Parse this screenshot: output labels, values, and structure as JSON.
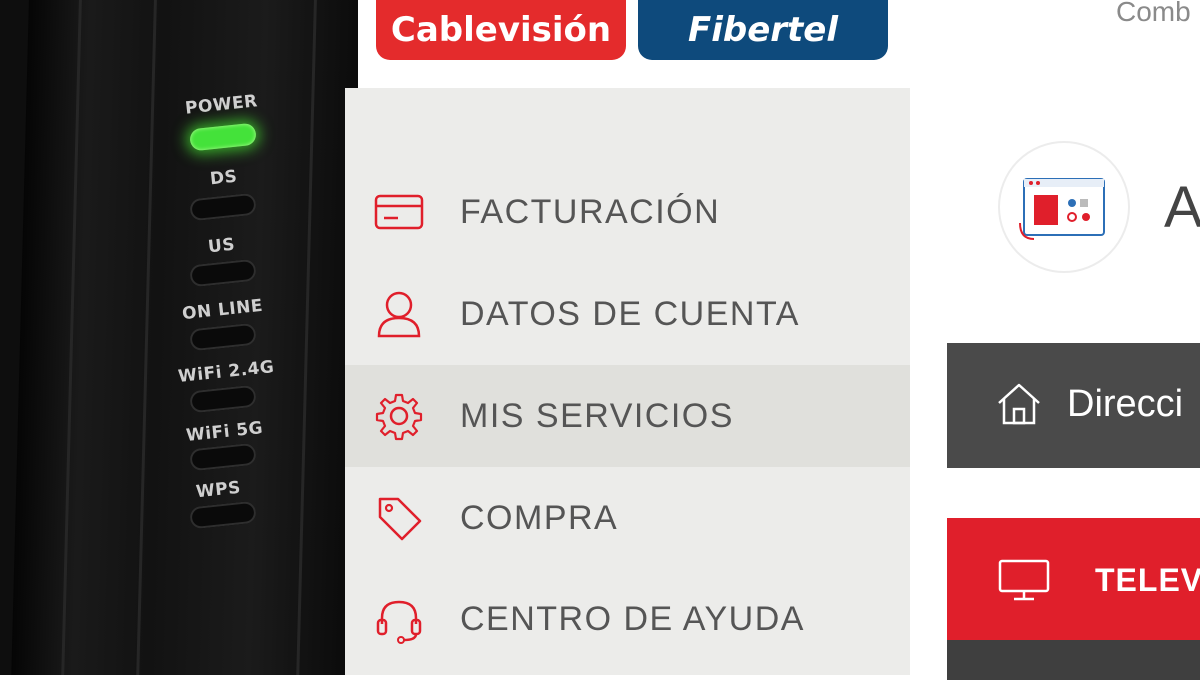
{
  "router": {
    "leds": [
      {
        "label": "POWER",
        "state": "on"
      },
      {
        "label": "DS",
        "state": "off"
      },
      {
        "label": "US",
        "state": "off"
      },
      {
        "label": "ON LINE",
        "state": "off"
      },
      {
        "label": "WiFi 2.4G",
        "state": "off"
      },
      {
        "label": "WiFi 5G",
        "state": "off"
      },
      {
        "label": "WPS",
        "state": "off"
      }
    ],
    "led_on_color": "#44e23a"
  },
  "header": {
    "logo_cablevision": "Cablevisión",
    "logo_fibertel": "Fibertel",
    "combo_text": "Comb"
  },
  "sidebar": {
    "items": [
      {
        "label": "FACTURACIÓN",
        "icon": "credit-card-icon",
        "active": false
      },
      {
        "label": "DATOS DE CUENTA",
        "icon": "user-icon",
        "active": false
      },
      {
        "label": "MIS SERVICIOS",
        "icon": "gear-icon",
        "active": true
      },
      {
        "label": "COMPRA",
        "icon": "tag-icon",
        "active": false
      },
      {
        "label": "CENTRO DE AYUDA",
        "icon": "headset-icon",
        "active": false
      }
    ]
  },
  "main": {
    "heading_initial": "A",
    "address_label": "Direcci",
    "service_label": "TELEV"
  },
  "colors": {
    "brand_red": "#e42b2c",
    "brand_blue": "#0e4a7c",
    "accent_red": "#e01f2b",
    "sidebar_bg": "#ececea",
    "dark_bar": "#4a4a4a"
  }
}
